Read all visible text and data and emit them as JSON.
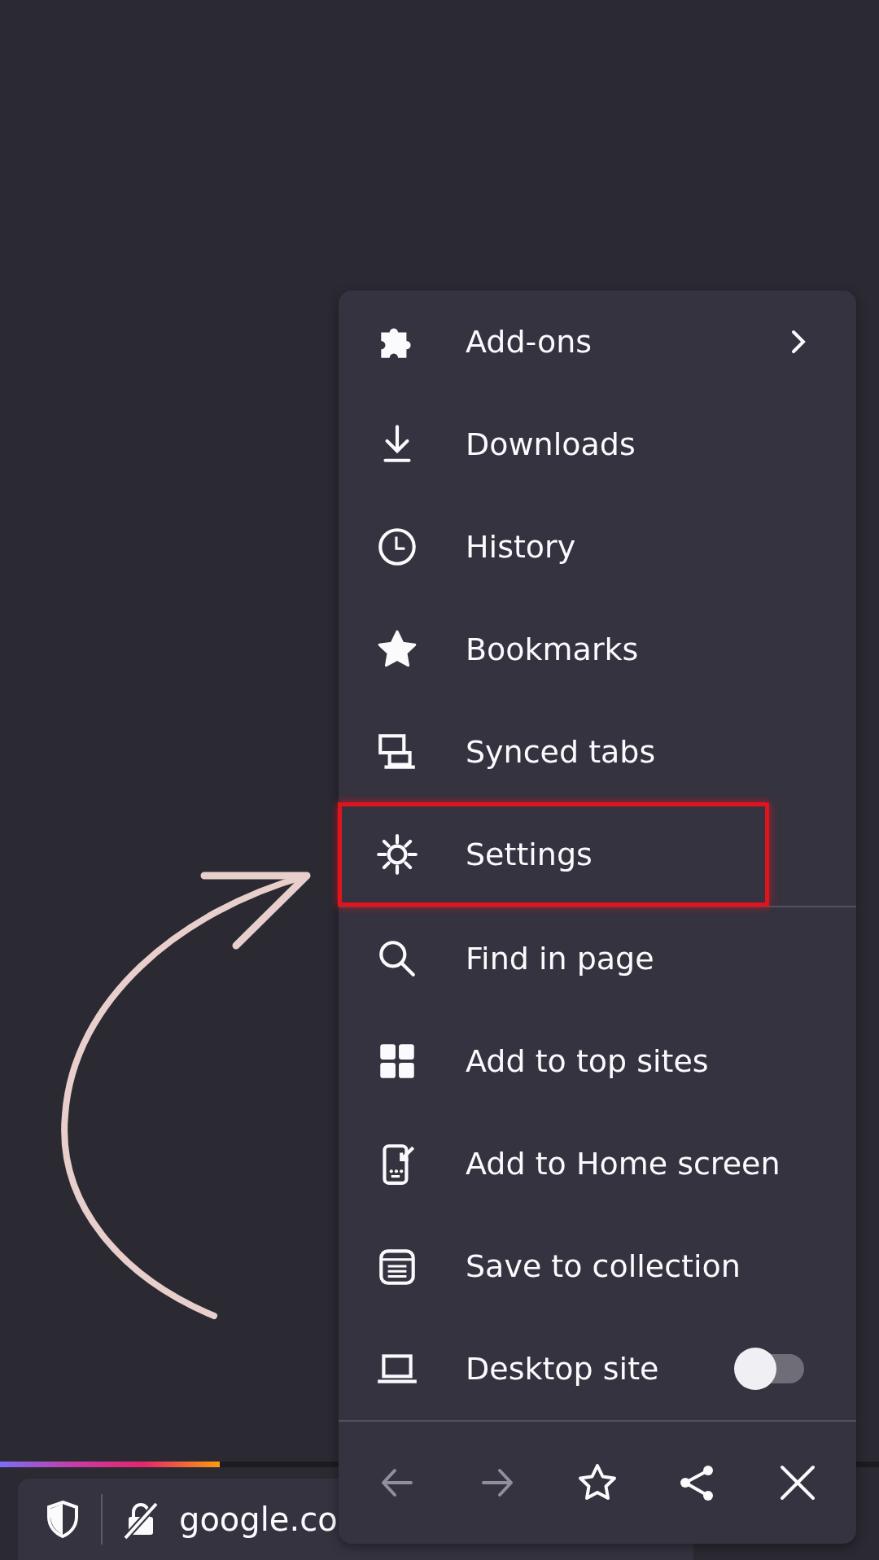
{
  "menu": {
    "items": [
      {
        "label": "Add-ons",
        "kind": "submenu",
        "highlighted": false
      },
      {
        "label": "Downloads",
        "kind": "plain",
        "highlighted": false
      },
      {
        "label": "History",
        "kind": "plain",
        "highlighted": false
      },
      {
        "label": "Bookmarks",
        "kind": "plain",
        "highlighted": false
      },
      {
        "label": "Synced tabs",
        "kind": "plain",
        "highlighted": false
      },
      {
        "label": "Settings",
        "kind": "plain",
        "highlighted": true
      },
      {
        "label": "Find in page",
        "kind": "plain",
        "highlighted": false
      },
      {
        "label": "Add to top sites",
        "kind": "plain",
        "highlighted": false
      },
      {
        "label": "Add to Home screen",
        "kind": "plain",
        "highlighted": false
      },
      {
        "label": "Save to collection",
        "kind": "plain",
        "highlighted": false
      },
      {
        "label": "Desktop site",
        "kind": "toggle",
        "on": false,
        "highlighted": false
      }
    ],
    "toolbar": [
      {
        "disabled": true
      },
      {
        "disabled": true
      },
      {
        "disabled": false
      },
      {
        "disabled": false
      },
      {
        "disabled": false
      }
    ]
  },
  "progress": {
    "level": 0.25
  },
  "address_bar": {
    "url": "google.co"
  }
}
